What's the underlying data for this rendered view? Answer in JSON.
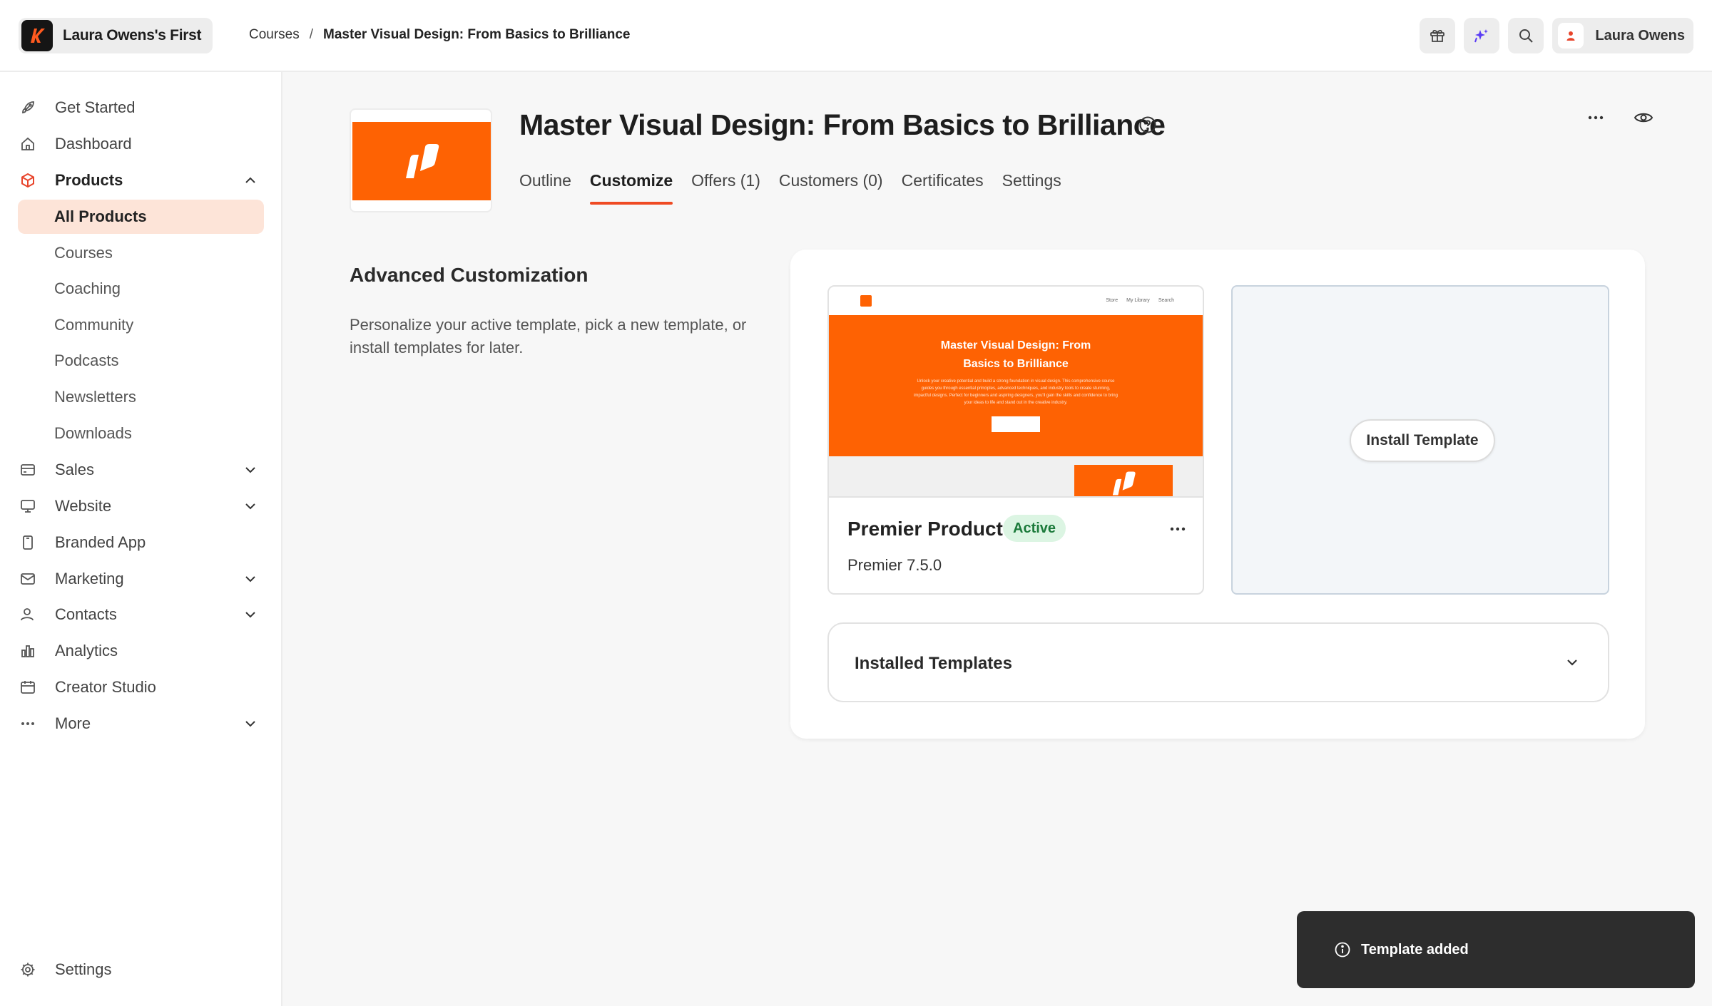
{
  "topbar": {
    "brand_name": "Laura Owens's First",
    "breadcrumb": {
      "parent": "Courses",
      "separator": "/",
      "current": "Master Visual Design: From Basics to Brilliance"
    },
    "user_name": "Laura Owens",
    "icons": [
      "gift-icon",
      "sparkle-icon",
      "search-icon",
      "user-icon"
    ]
  },
  "sidebar": {
    "items": [
      {
        "label": "Get Started",
        "icon": "rocket-icon"
      },
      {
        "label": "Dashboard",
        "icon": "home-icon"
      },
      {
        "label": "Products",
        "icon": "box-icon",
        "expanded": true
      },
      {
        "label": "Sales",
        "icon": "card-icon"
      },
      {
        "label": "Website",
        "icon": "monitor-icon"
      },
      {
        "label": "Branded App",
        "icon": "phone-icon"
      },
      {
        "label": "Marketing",
        "icon": "mail-icon"
      },
      {
        "label": "Contacts",
        "icon": "contacts-icon"
      },
      {
        "label": "Analytics",
        "icon": "chart-icon"
      },
      {
        "label": "Creator Studio",
        "icon": "calendar-icon"
      },
      {
        "label": "More",
        "icon": "dots-icon"
      }
    ],
    "products_sub": [
      "All Products",
      "Courses",
      "Coaching",
      "Community",
      "Podcasts",
      "Newsletters",
      "Downloads"
    ],
    "settings_label": "Settings"
  },
  "main": {
    "title": "Master Visual Design: From Basics to Brilliance",
    "tabs": [
      "Outline",
      "Customize",
      "Offers (1)",
      "Customers (0)",
      "Certificates",
      "Settings"
    ],
    "active_tab": "Customize",
    "section_title": "Advanced Customization",
    "section_desc": "Personalize your active template, pick a new template, or install templates for later.",
    "template": {
      "name": "Premier Product",
      "status": "Active",
      "version": "Premier 7.5.0",
      "preview": {
        "nav": [
          "Store",
          "My Library",
          "Search"
        ],
        "hero_title": "Master Visual Design: From Basics to Brilliance",
        "hero_body": "Unlock your creative potential and build a strong foundation in visual design. This comprehensive course guides you through essential principles, advanced techniques, and industry tools to create stunning, impactful designs. Perfect for beginners and aspiring designers, you'll gain the skills and confidence to bring your ideas to life and stand out in the creative industry."
      }
    },
    "install_button": "Install Template",
    "installed_templates": "Installed Templates"
  },
  "toast": {
    "message": "Template added"
  },
  "colors": {
    "accent": "#ef4a23",
    "brand_orange": "#fe6203",
    "active_bg": "#fde4d8",
    "badge_bg": "#dcf5e3",
    "badge_text": "#1b7a3a",
    "toast_bg": "#2d2d2d"
  }
}
